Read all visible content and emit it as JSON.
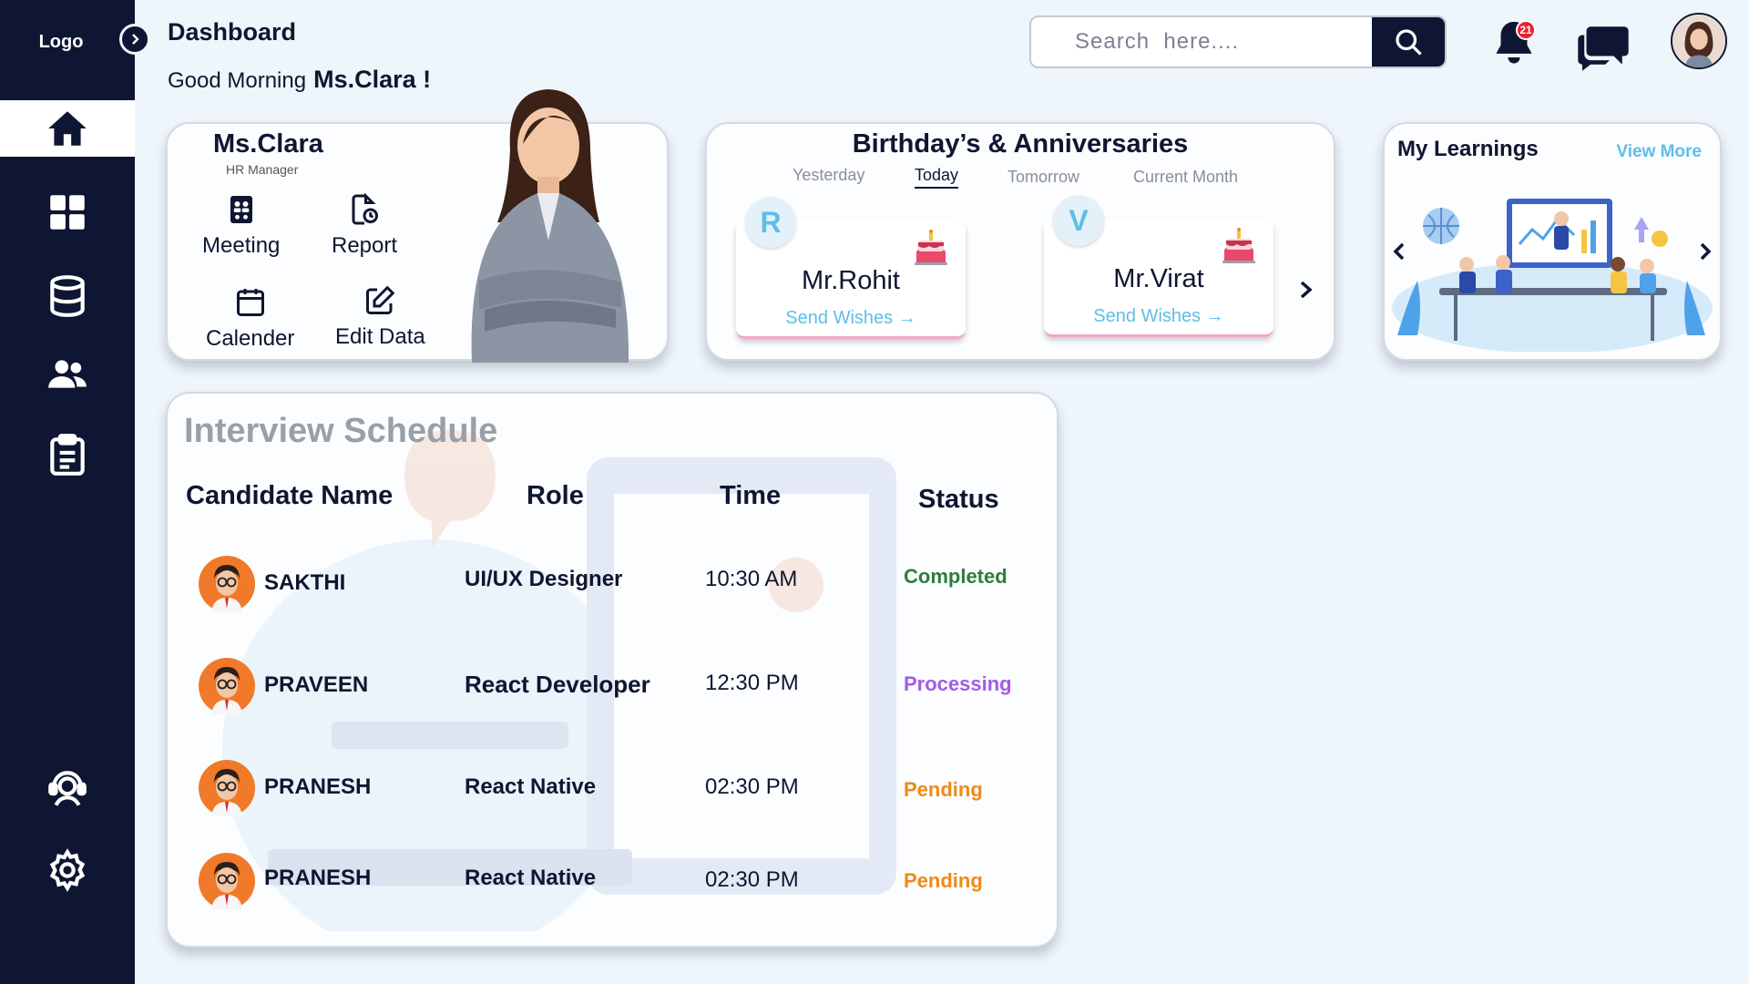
{
  "sidebar": {
    "logo": "Logo",
    "items": [
      {
        "label": "Home",
        "icon": "home-icon"
      },
      {
        "label": "Apps",
        "icon": "grid-icon"
      },
      {
        "label": "Database",
        "icon": "database-icon"
      },
      {
        "label": "Users",
        "icon": "users-icon"
      },
      {
        "label": "Tasks",
        "icon": "clipboard-icon"
      },
      {
        "label": "Support",
        "icon": "support-icon"
      },
      {
        "label": "Settings",
        "icon": "gear-icon"
      }
    ]
  },
  "header": {
    "title": "Dashboard",
    "greeting": "Good Morning",
    "user_name": "Ms.Clara !",
    "search_placeholder": "Search  here....",
    "notification_count": "21"
  },
  "profile": {
    "name": "Ms.Clara",
    "role": "HR Manager",
    "actions": [
      {
        "label": "Meeting",
        "icon": "meeting-icon"
      },
      {
        "label": "Report",
        "icon": "report-icon"
      },
      {
        "label": "Calender",
        "icon": "calendar-icon"
      },
      {
        "label": "Edit Data",
        "icon": "edit-icon"
      }
    ]
  },
  "birthdays": {
    "title": "Birthday’s & Anniversaries",
    "tabs": [
      "Yesterday",
      "Today",
      "Tomorrow",
      "Current Month"
    ],
    "active_tab": "Today",
    "people": [
      {
        "initial": "R",
        "name": "Mr.Rohit",
        "action": "Send Wishes →"
      },
      {
        "initial": "V",
        "name": "Mr.Virat",
        "action": "Send Wishes →"
      }
    ]
  },
  "learnings": {
    "title": "My Learnings",
    "view_more": "View More"
  },
  "interviews": {
    "title": "Interview Schedule",
    "columns": [
      "Candidate Name",
      "Role",
      "Time",
      "Status"
    ],
    "rows": [
      {
        "name": "SAKTHI",
        "role": "UI/UX Designer",
        "time": "10:30 AM",
        "status": "Completed"
      },
      {
        "name": "PRAVEEN",
        "role": "React Developer",
        "time": "12:30 PM",
        "status": "Processing"
      },
      {
        "name": "PRANESH",
        "role": "React Native",
        "time": "02:30 PM",
        "status": "Pending"
      },
      {
        "name": "PRANESH",
        "role": "React Native",
        "time": "02:30 PM",
        "status": "Pending"
      }
    ]
  },
  "colors": {
    "sidebar": "#0e1633",
    "accent": "#5fbde9",
    "completed": "#2e7d3a",
    "processing": "#a35be6",
    "pending": "#f08a17",
    "badge": "#e5232f"
  }
}
